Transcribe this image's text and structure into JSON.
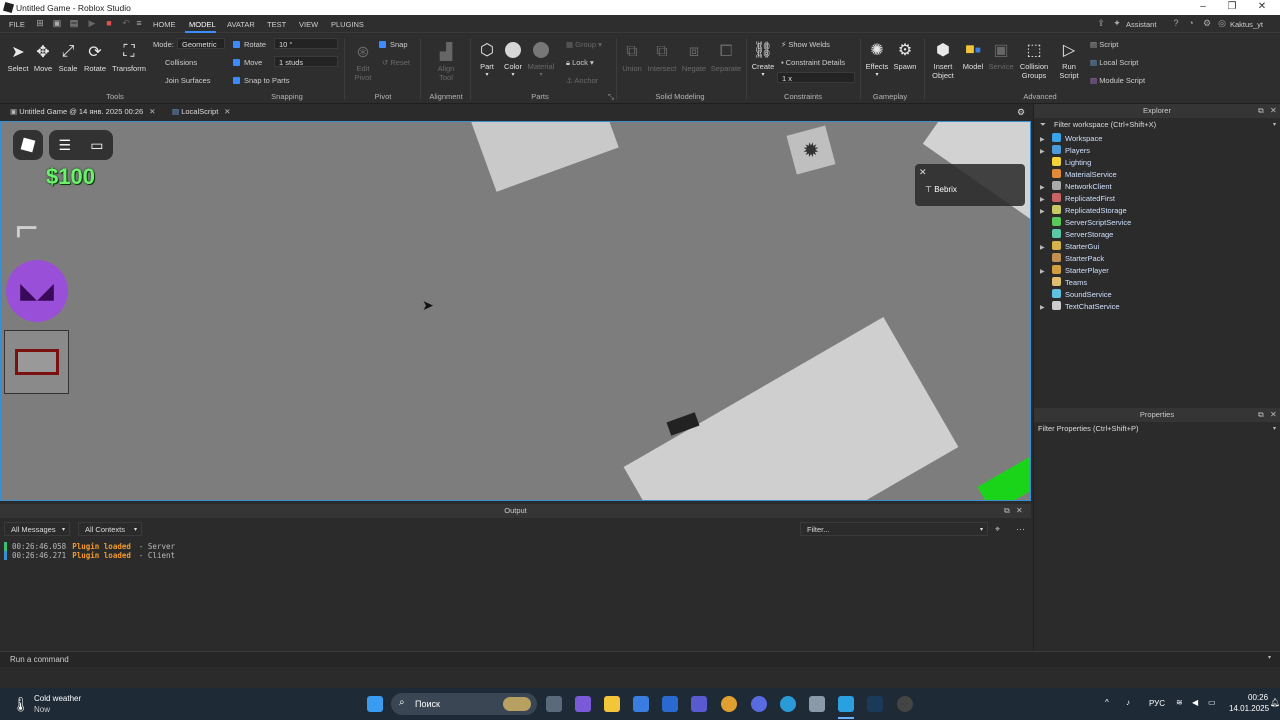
{
  "window": {
    "title": "Untitled Game - Roblox Studio"
  },
  "menubar": {
    "tabs": [
      "FILE",
      "HOME",
      "MODEL",
      "AVATAR",
      "TEST",
      "VIEW",
      "PLUGINS"
    ],
    "assistant": "Assistant",
    "user": "Kaktus_yt"
  },
  "ribbon": {
    "tools": {
      "select": "Select",
      "move": "Move",
      "scale": "Scale",
      "rotate": "Rotate",
      "transform": "Transform",
      "group": "Tools"
    },
    "mode": {
      "label": "Mode:",
      "value": "Geometric",
      "collisions": "Collisions",
      "join_surfaces": "Join Surfaces"
    },
    "snapping": {
      "rotate_label": "Rotate",
      "rotate_value": "10 °",
      "move_label": "Move",
      "move_value": "1 studs",
      "snap_to_parts": "Snap to Parts",
      "group": "Snapping"
    },
    "pivot": {
      "edit_pivot": "Edit\nPivot",
      "snap": "Snap",
      "reset": "Reset",
      "group": "Pivot"
    },
    "alignment": {
      "align_tool": "Align\nTool",
      "group": "Alignment"
    },
    "parts": {
      "part": "Part",
      "color": "Color",
      "material": "Material",
      "group_btn": "Group",
      "lock": "Lock",
      "anchor": "Anchor",
      "group": "Parts"
    },
    "solid": {
      "union": "Union",
      "intersect": "Intersect",
      "negate": "Negate",
      "separate": "Separate",
      "group": "Solid Modeling"
    },
    "constraints": {
      "create": "Create",
      "show_welds": "Show Welds",
      "constraint_details": "Constraint Details",
      "scale": "1 x",
      "group": "Constraints"
    },
    "gameplay": {
      "effects": "Effects",
      "spawn": "Spawn",
      "group": "Gameplay"
    },
    "advanced": {
      "insert_object": "Insert\nObject",
      "model": "Model",
      "service": "Service",
      "collision_groups": "Collision\nGroups",
      "run_script": "Run\nScript",
      "script": "Script",
      "local_script": "Local Script",
      "module_script": "Module Script",
      "group": "Advanced"
    }
  },
  "doctabs": [
    {
      "label": "Untitled Game @ 14 янв. 2025 00:26"
    },
    {
      "label": "LocalScript"
    }
  ],
  "viewport": {
    "money": "$100",
    "toast_text": "Bebrix",
    "colors": {
      "money": "#6df06d",
      "selection": "#3a8fd0"
    }
  },
  "explorer": {
    "title": "Explorer",
    "filter": "Filter workspace (Ctrl+Shift+X)",
    "items": [
      {
        "label": "Workspace",
        "icon": "globe-icon",
        "color": "#3aa3e8",
        "expand": true
      },
      {
        "label": "Players",
        "icon": "players-icon",
        "color": "#4a9bd8",
        "expand": true
      },
      {
        "label": "Lighting",
        "icon": "lightbulb-icon",
        "color": "#f2d43a",
        "expand": false
      },
      {
        "label": "MaterialService",
        "icon": "material-icon",
        "color": "#e08a3a",
        "expand": false
      },
      {
        "label": "NetworkClient",
        "icon": "network-icon",
        "color": "#aaaaaa",
        "expand": true
      },
      {
        "label": "ReplicatedFirst",
        "icon": "replicated-icon",
        "color": "#c86464",
        "expand": true
      },
      {
        "label": "ReplicatedStorage",
        "icon": "storage-icon",
        "color": "#c8c864",
        "expand": true
      },
      {
        "label": "ServerScriptService",
        "icon": "script-service-icon",
        "color": "#5bc85b",
        "expand": false
      },
      {
        "label": "ServerStorage",
        "icon": "server-storage-icon",
        "color": "#5bc8a8",
        "expand": false
      },
      {
        "label": "StarterGui",
        "icon": "gui-icon",
        "color": "#d6b24a",
        "expand": true
      },
      {
        "label": "StarterPack",
        "icon": "pack-icon",
        "color": "#c09050",
        "expand": false
      },
      {
        "label": "StarterPlayer",
        "icon": "starter-player-icon",
        "color": "#d0a040",
        "expand": true
      },
      {
        "label": "Teams",
        "icon": "teams-icon",
        "color": "#e0c070",
        "expand": false
      },
      {
        "label": "SoundService",
        "icon": "sound-icon",
        "color": "#60c0e0",
        "expand": false
      },
      {
        "label": "TextChatService",
        "icon": "chat-icon",
        "color": "#cccccc",
        "expand": true
      }
    ]
  },
  "properties": {
    "title": "Properties",
    "filter": "Filter Properties (Ctrl+Shift+P)"
  },
  "output": {
    "title": "Output",
    "messages_dropdown": "All Messages",
    "contexts_dropdown": "All Contexts",
    "filter_placeholder": "Filter...",
    "logs": [
      {
        "time": "00:26:46.058",
        "message": "Plugin loaded",
        "source": "-  Server",
        "marker": "#3ac070"
      },
      {
        "time": "00:26:46.271",
        "message": "Plugin loaded",
        "source": "-  Client",
        "marker": "#3a8fd0"
      }
    ]
  },
  "command": {
    "placeholder": "Run a command"
  },
  "taskbar": {
    "weather_title": "Cold weather",
    "weather_sub": "Now",
    "search_placeholder": "Поиск",
    "lang": "РУС",
    "time": "00:26",
    "date": "14.01.2025"
  }
}
